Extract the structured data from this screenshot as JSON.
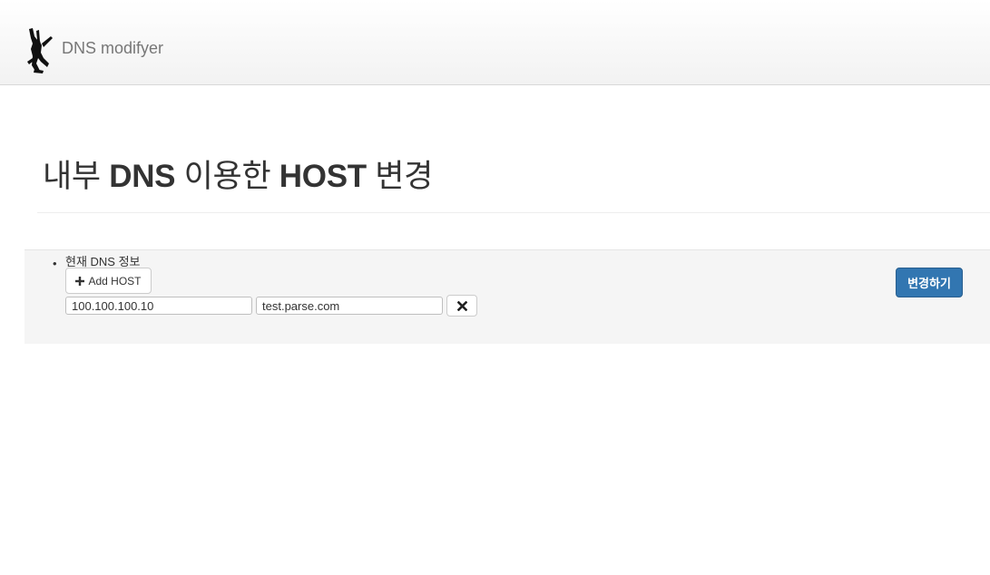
{
  "navbar": {
    "brand": "DNS modifyer",
    "logo_icon": "jumping-person-icon"
  },
  "page": {
    "title_part1": "내부 ",
    "title_part2": "DNS",
    "title_part3": " 이용한 ",
    "title_part4": "HOST",
    "title_part5": " 변경"
  },
  "dns_section": {
    "bullet": "•",
    "label": "현재 DNS 정보",
    "add_button_label": "Add HOST",
    "add_icon": "plus-icon",
    "entries": [
      {
        "ip": "100.100.100.10",
        "host": "test.parse.com",
        "remove_icon": "close-icon"
      }
    ]
  },
  "actions": {
    "submit_label": "변경하기",
    "submit_color": "#3276b1"
  }
}
